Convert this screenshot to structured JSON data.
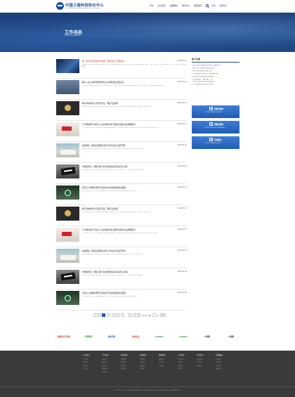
{
  "header": {
    "logo_cn": "中国工程科技知识中心",
    "logo_en": "China Knowledge Centre for Engineering Sciences and Technology",
    "nav": [
      "首页",
      "关于我们",
      "政策解读",
      "服务中心",
      "联系我们"
    ],
    "cta_search": "检索",
    "cta_register": "注册登录"
  },
  "banner": {
    "title": "工作动态",
    "subtitle": "WORK DYNAMICS"
  },
  "news": [
    {
      "title": "唯一的芯片服务联合体 揭牌：国家创新工程稳运营",
      "date": "2019-01-14",
      "desc": "中国芯片服务联合体成立暨揭牌仪式在北京举行，来自各地的代表参加了本次活动。联合体将围绕芯片设计、制造、封测等环节开展协同服务，推动产业链上下游的深度融合。",
      "thumb": "t0",
      "hl": true
    },
    {
      "title": "椰子入驻上海市市场监管局公告 团队委员会及信息",
      "date": "2019-01-14",
      "desc": "上海市市场监督管理局发布关于椰子品牌相关公告，明确了相关团队委员会的组成及职责，对市场主体进一步规范经营提出具体要求。",
      "thumb": "t1",
      "hl": false
    },
    {
      "title": "椰子科技有限公司首营产品，团队产品注册",
      "date": "2019-01-13",
      "desc": "椰子科技有限公司发布首营产品并完成团队产品注册手续，公司表示将继续加大研发投入，推动新产品尽快上市。",
      "thumb": "t2",
      "hl": false
    },
    {
      "title": "字节跳动旗下抖音与公众新闻客户端 监测到违规信息后删除账号",
      "date": "2019-01-13",
      "desc": "字节跳动旗下抖音与公众新闻客户端宣布加强内容审核，对监测到的违规信息及相关账号进行集中清理，维护网络空间秩序。",
      "thumb": "t3",
      "hl": false
    },
    {
      "title": "电商团队：国家反垄断执法部门对外卖平台展开调查",
      "date": "2019-01-12",
      "desc": "国家反垄断执法部门宣布对外卖平台展开调查，重点关注平台与商户之间的合作条款及相关竞争行为。",
      "thumb": "t4",
      "hl": false
    },
    {
      "title": "市场监管局：'网络订餐' 专项 检测出多家外卖平台违规",
      "date": "2019-01-12",
      "desc": "市场监管局开展网络订餐专项检查，检测出多家外卖平台存在违规行为，已责令相关企业限期整改。",
      "thumb": "t5",
      "hl": false
    },
    {
      "title": "星巴克与中国阿里巴巴全面合作 新零售推出外送服务",
      "date": "2019-01-11",
      "desc": "星巴克宣布与阿里巴巴达成全面战略合作，依托新零售体系在国内主要城市推出外送服务。",
      "thumb": "t6",
      "hl": false
    },
    {
      "title": "椰子科技有限公司首营产品，团队产品注册",
      "date": "2019-01-10",
      "desc": "椰子科技有限公司发布首营产品并完成团队产品注册手续，公司表示将继续加大研发投入，推动新产品尽快上市。",
      "thumb": "t2",
      "hl": false
    },
    {
      "title": "字节跳动旗下抖音与公众新闻客户端 监测到违规信息后删除账号",
      "date": "2019-01-10",
      "desc": "字节跳动旗下抖音与公众新闻客户端宣布加强内容审核，对监测到的违规信息及相关账号进行集中清理，维护网络空间秩序。",
      "thumb": "t3",
      "hl": false
    },
    {
      "title": "电商团队：国家反垄断执法部门对外卖平台展开调查",
      "date": "2019-01-09",
      "desc": "国家反垄断执法部门宣布对外卖平台展开调查，重点关注平台与商户之间的合作条款及相关竞争行为。",
      "thumb": "t4",
      "hl": false
    },
    {
      "title": "市场监管局：'网络订餐' 专项 检测出多家外卖平台违规",
      "date": "2019-01-09",
      "desc": "市场监管局开展网络订餐专项检查，检测出多家外卖平台存在违规行为，已责令相关企业限期整改。",
      "thumb": "t5",
      "hl": false
    },
    {
      "title": "星巴克与中国阿里巴巴全面合作 新零售推出外送服务",
      "date": "2019-01-08",
      "desc": "星巴克宣布与阿里巴巴达成全面战略合作，依托新零售体系在国内主要城市推出外送服务。",
      "thumb": "t6",
      "hl": false
    }
  ],
  "sidebar": {
    "heading": "热门文章",
    "links": [
      "1 唯一的芯片服务联合体 揭牌：国家创新...",
      "2 椰子入驻上海市市场监管局公告...",
      "3 椰子科技有限公司首营产品...",
      "4 字节跳动旗下抖音与公众新闻客户端...",
      "5 电商团队：国家反垄断执法部门...",
      "6 市场监管局：'网络订餐' 专项...",
      "7 星巴克与中国阿里巴巴全面合作...",
      "8 字节跳动旗下抖音与公众新闻..."
    ],
    "buttons": [
      {
        "cn": "新颖性检索",
        "en": "NOVELTY SEARCH AGENCY"
      },
      {
        "cn": "新颖性检索",
        "en": "NOVELTY SEARCH KNOWLEDGE"
      },
      {
        "cn": "查新报告",
        "en": "NOVELTY SEARCH CASE"
      }
    ]
  },
  "pager": {
    "prev": "上一页",
    "pages": [
      "1",
      "2",
      "3",
      "4",
      "5"
    ],
    "ellipsis": "...",
    "last": "17",
    "next": "下一页",
    "total": "共17页，到第",
    "page_suffix": "页",
    "go": "确定"
  },
  "partners": [
    {
      "name": "国家知识产权局",
      "color": "#c0392b"
    },
    {
      "name": "一流查新所",
      "color": "#2e7d32"
    },
    {
      "name": "科技查新",
      "color": "#1e4e9c"
    },
    {
      "name": "中信征信",
      "color": "#c0392b"
    },
    {
      "name": "AmpMaxx",
      "color": "#2e7d32"
    },
    {
      "name": "AmpMaxx",
      "color": "#2e7d32"
    },
    {
      "name": "D 智慧",
      "color": "#1b1b1b"
    },
    {
      "name": "D 智慧",
      "color": "#1b1b1b"
    }
  ],
  "footer": {
    "columns": [
      {
        "head": "关于我们",
        "items": [
          "中心简介",
          "组织机构",
          "联系方式",
          "加入我们"
        ]
      },
      {
        "head": "工作动态",
        "items": [
          "新闻中心",
          "通知公告",
          "行业资讯",
          "媒体报道",
          "专题活动"
        ]
      },
      {
        "head": "科技查新",
        "items": [
          "查新服务",
          "查新流程",
          "收费标准",
          "常见问题"
        ]
      },
      {
        "head": "知识服务",
        "items": [
          "文献检索",
          "专利分析",
          "情报研究",
          "数据服务"
        ]
      },
      {
        "head": "政策解读",
        "items": [
          "国家政策",
          "地方政策",
          "行业标准"
        ]
      },
      {
        "head": "人才服务",
        "items": [
          "人才招聘",
          "专家库",
          "培训服务",
          "交流合作"
        ]
      },
      {
        "head": "合作伙伴",
        "items": [
          "合作机构",
          "合作项目",
          "加盟合作"
        ]
      },
      {
        "head": "在线客服",
        "items": [
          "在线咨询",
          "意见反馈",
          "投诉建议",
          "网站地图"
        ]
      }
    ],
    "copyright": "COPYRIGHT © 2015-2019 中国工程科技知识中心 版权所有  京ICP备 XXXXXXXX号  技术支持：中国工程院信息中心"
  }
}
